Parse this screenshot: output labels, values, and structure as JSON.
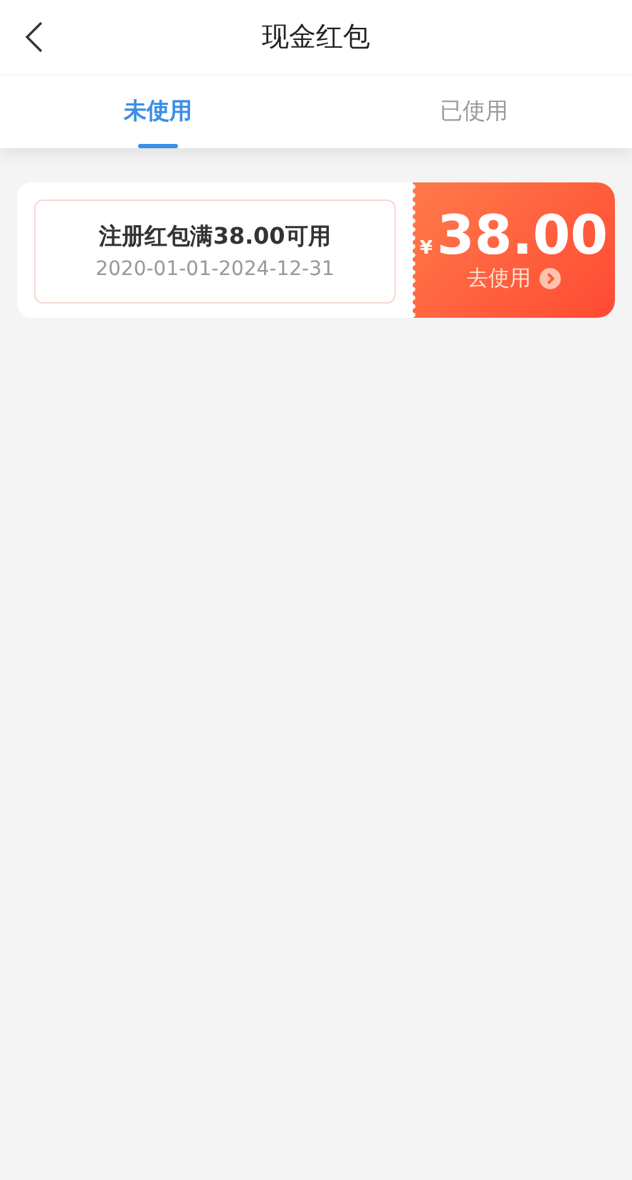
{
  "header": {
    "title": "现金红包"
  },
  "tabs": [
    {
      "label": "未使用",
      "selected": true
    },
    {
      "label": "已使用",
      "selected": false
    }
  ],
  "coupons": [
    {
      "condition": "注册红包满38.00可用",
      "validity": "2020-01-01-2024-12-31",
      "currency": "¥",
      "amount": "38.00",
      "action": "去使用"
    }
  ]
}
